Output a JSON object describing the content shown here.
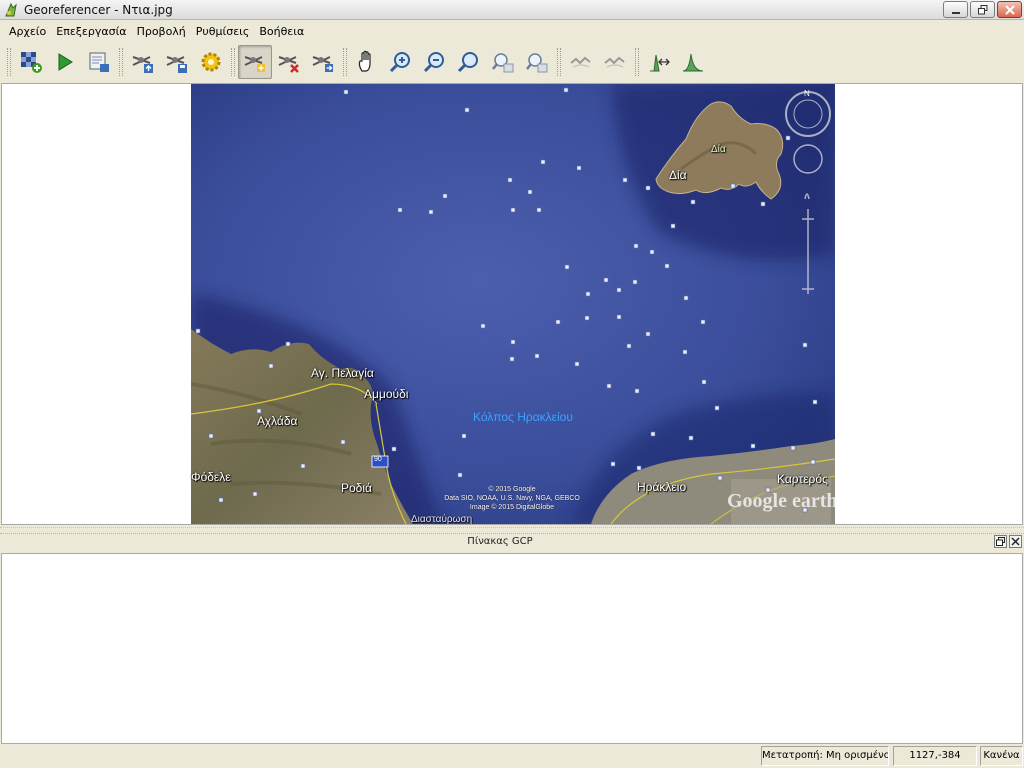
{
  "window": {
    "title": "Georeferencer - Ντια.jpg",
    "app_icon": "qgis-georeferencer-icon"
  },
  "menubar": {
    "items": [
      "Αρχείο",
      "Επεξεργασία",
      "Προβολή",
      "Ρυθμίσεις",
      "Βοήθεια"
    ]
  },
  "toolbar": {
    "buttons": [
      "open-raster-icon",
      "start-georeferencing-icon",
      "generate-gdal-script-icon",
      "load-gcp-points-icon",
      "save-gcp-points-icon",
      "transformation-settings-icon",
      "add-point-icon",
      "delete-point-icon",
      "move-gcp-point-icon",
      "pan-icon",
      "zoom-in-icon",
      "zoom-out-icon",
      "zoom-to-layer-icon",
      "zoom-last-icon",
      "zoom-next-icon",
      "link-georeferencer-icon",
      "link-qgis-icon",
      "full-histogram-stretch-icon",
      "local-histogram-stretch-icon"
    ],
    "active": "add-point-icon"
  },
  "map": {
    "labels": {
      "dia_island": "Δία",
      "dia_village": "Δία",
      "ag_pelagia": "Αγ. Πελαγία",
      "ammoudi": "Αμμούδι",
      "achlada": "Αχλάδα",
      "fodele": "Φόδελε",
      "rodia": "Ροδιά",
      "irakleio": "Ηράκλειο",
      "karteros": "Καρτερός",
      "gulf": "Κόλπος Ηρακλείου",
      "road_sign": "90",
      "bottom_partial": "Διασταύρωση"
    },
    "attribution": [
      "© 2015 Google",
      "Data SIO, NOAA, U.S. Navy, NGA, GEBCO",
      "Image © 2015 DigitalGlobe"
    ],
    "logo": "Google earth",
    "colors": {
      "sea": "#2f3f8c",
      "sea_light": "#4458a8",
      "land": "#7d7356"
    }
  },
  "gcp_panel": {
    "title": "Πίνακας GCP"
  },
  "statusbar": {
    "transform": "Μετατροπή: Μη ορισμένο",
    "coordinates": "1127,-384",
    "crs": "Κανένα"
  }
}
